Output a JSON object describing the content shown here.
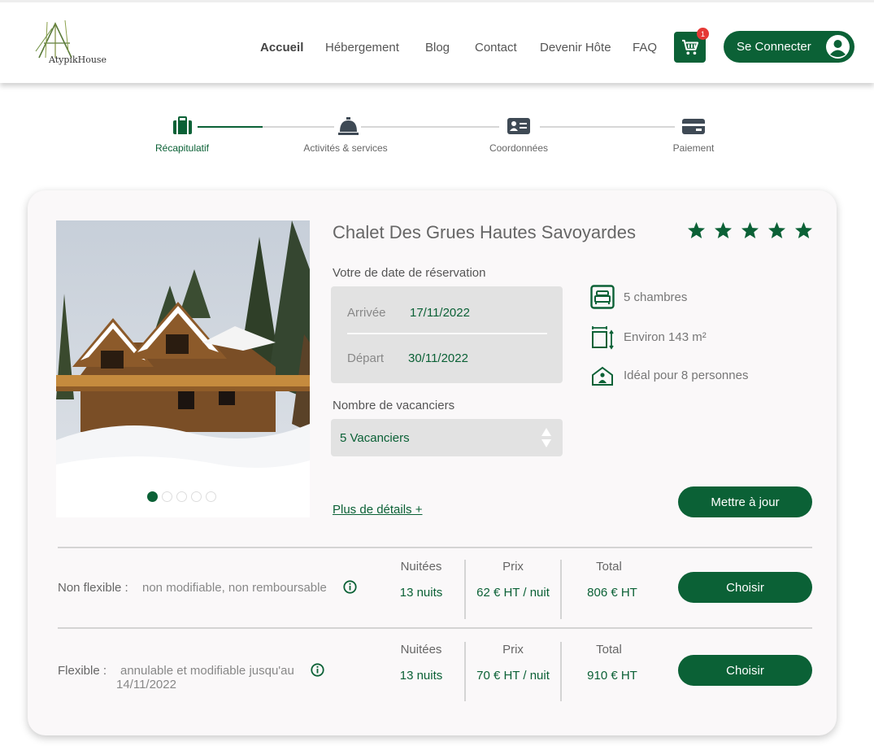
{
  "header": {
    "logo_text": "AtypikHouse",
    "nav": [
      {
        "label": "Accueil",
        "active": true
      },
      {
        "label": "Hébergement",
        "active": false
      },
      {
        "label": "Blog",
        "active": false
      },
      {
        "label": "Contact",
        "active": false
      },
      {
        "label": "Devenir Hôte",
        "active": false
      },
      {
        "label": "FAQ",
        "active": false
      }
    ],
    "cart_count": "1",
    "login_label": "Se Connecter",
    "cart_icon": "cart-icon",
    "avatar_icon": "user-circle-icon"
  },
  "stepper": {
    "steps": [
      {
        "label": "Récapitulatif",
        "icon": "suitcase-icon",
        "active": true
      },
      {
        "label": "Activités & services",
        "icon": "service-bell-icon",
        "active": false
      },
      {
        "label": "Coordonnées",
        "icon": "id-card-icon",
        "active": false
      },
      {
        "label": "Paiement",
        "icon": "credit-card-icon",
        "active": false
      }
    ]
  },
  "listing": {
    "title": "Chalet Des Grues Hautes Savoyardes",
    "rating": 5,
    "reservation_label": "Votre de date de réservation",
    "arrival_label": "Arrivée",
    "arrival_date": "17/11/2022",
    "departure_label": "Départ",
    "departure_date": "30/11/2022",
    "guests_label": "Nombre de vacanciers",
    "guests_value": "5 Vacanciers",
    "features": [
      {
        "icon": "bed-icon",
        "text": "5 chambres"
      },
      {
        "icon": "area-icon",
        "text": "Environ 143 m²"
      },
      {
        "icon": "house-person-icon",
        "text": "Idéal pour 8 personnes"
      }
    ],
    "details_link": "Plus de détails +",
    "update_label": "Mettre à jour",
    "carousel_count": 5,
    "carousel_active": 0
  },
  "rates": [
    {
      "name": "Non flexible :",
      "desc_line1": "non modifiable, non remboursable",
      "desc_line2": "",
      "nights_header": "Nuitées",
      "nights": "13 nuits",
      "price_header": "Prix",
      "price": "62 € HT / nuit",
      "total_header": "Total",
      "total": "806 € HT",
      "choose_label": "Choisir"
    },
    {
      "name": "Flexible :",
      "desc_line1": "annulable et modifiable jusqu'au",
      "desc_line2": "14/11/2022",
      "nights_header": "Nuitées",
      "nights": "13 nuits",
      "price_header": "Prix",
      "price": "70 € HT / nuit",
      "total_header": "Total",
      "total": "910 € HT",
      "choose_label": "Choisir"
    }
  ],
  "colors": {
    "brand_green": "#0b6136",
    "badge_red": "#e53935"
  }
}
